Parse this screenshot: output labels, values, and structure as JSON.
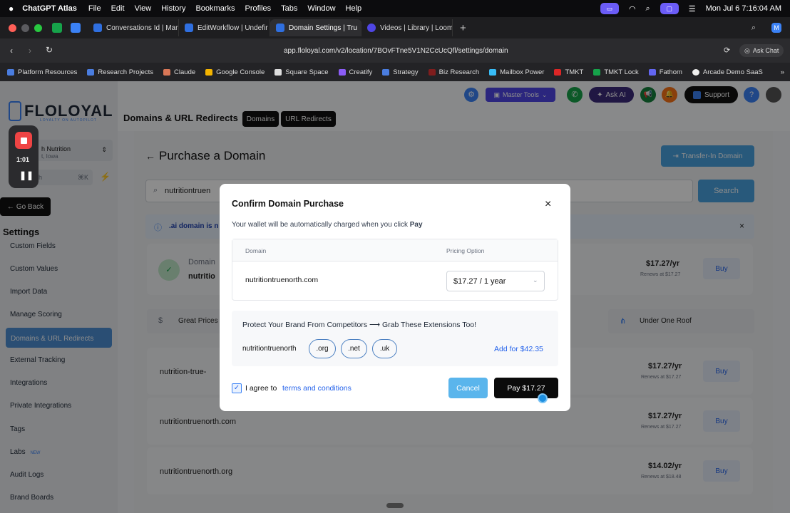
{
  "menubar": {
    "app": "ChatGPT Atlas",
    "items": [
      "File",
      "Edit",
      "View",
      "History",
      "Bookmarks",
      "Profiles",
      "Tabs",
      "Window",
      "Help"
    ],
    "datetime": "Mon Jul 6  7:16:04 AM"
  },
  "tabs": [
    {
      "label": "Conversations Id | Mar"
    },
    {
      "label": "EditWorkflow | Undefir"
    },
    {
      "label": "Domain Settings | Tru"
    },
    {
      "label": "Videos | Library | Loom"
    }
  ],
  "address": {
    "url": "app.floloyal.com/v2/location/7BOvFTne5V1N2CcUcQfl/settings/domain",
    "ask_chat": "Ask Chat"
  },
  "bookmarks": [
    "Platform Resources",
    "Research Projects",
    "Claude",
    "Google Console",
    "Square Space",
    "Creatify",
    "Strategy",
    "Biz Research",
    "Mailbox Power",
    "TMKT",
    "TMKT Lock",
    "Fathom",
    "Arcade Demo SaaS"
  ],
  "brand": {
    "logo_text": "FLOLOYAL",
    "tagline": "LOYALTY ON AUTOPILOT"
  },
  "location": {
    "name": "h Nutrition",
    "sub": "t, Iowa"
  },
  "recorder": {
    "time": "1:01"
  },
  "search_shortcut": "⌘K",
  "search_partial": "h",
  "go_back": "Go Back",
  "settings_heading": "Settings",
  "nav": [
    "Custom Fields",
    "Custom Values",
    "Import Data",
    "Manage Scoring",
    "Domains & URL Redirects",
    "External Tracking",
    "Integrations",
    "Private Integrations",
    "Tags",
    "Labs",
    "Audit Logs",
    "Brand Boards"
  ],
  "nav_new_badge": "NEW",
  "header": {
    "title": "Domains & URL Redirects",
    "tab_domains": "Domains",
    "tab_redirects": "URL Redirects",
    "master_tools": "Master Tools",
    "ask_ai": "Ask AI",
    "support": "Support"
  },
  "page": {
    "title": "Purchase a Domain",
    "transfer_btn": "Transfer-In Domain",
    "search_value": "nutritiontruen",
    "search_btn": "Search",
    "info_text": ".ai domain is n",
    "domain_label": "Domain",
    "domain_value": "nutritio",
    "great_prices": "Great Prices",
    "under_one_roof": "Under One Roof",
    "buy_label": "Buy"
  },
  "results": [
    {
      "domain": "",
      "price": "$17.27/yr",
      "renews": "Renews at $17.27"
    },
    {
      "domain": "nutrition-true-",
      "price": "$17.27/yr",
      "renews": "Renews at $17.27"
    },
    {
      "domain": "nutritiontruenorth.com",
      "price": "$17.27/yr",
      "renews": "Renews at $17.27"
    },
    {
      "domain": "nutritiontruenorth.org",
      "price": "$14.02/yr",
      "renews": "Renews at $18.48"
    }
  ],
  "modal": {
    "title": "Confirm Domain Purchase",
    "subtitle_pre": "Your wallet will be automatically charged when you click ",
    "subtitle_bold": "Pay",
    "col_domain": "Domain",
    "col_pricing": "Pricing Option",
    "domain": "nutritiontruenorth.com",
    "pricing_selected": "$17.27 / 1 year",
    "protect_text": "Protect Your Brand From Competitors ⟶ Grab These Extensions Too!",
    "ext_base": "nutritiontruenorth",
    "extensions": [
      ".org",
      ".net",
      ".uk"
    ],
    "add_for": "Add for $42.35",
    "agree": "I agree to",
    "terms": "terms and conditions",
    "cancel": "Cancel",
    "pay": "Pay $17.27"
  }
}
